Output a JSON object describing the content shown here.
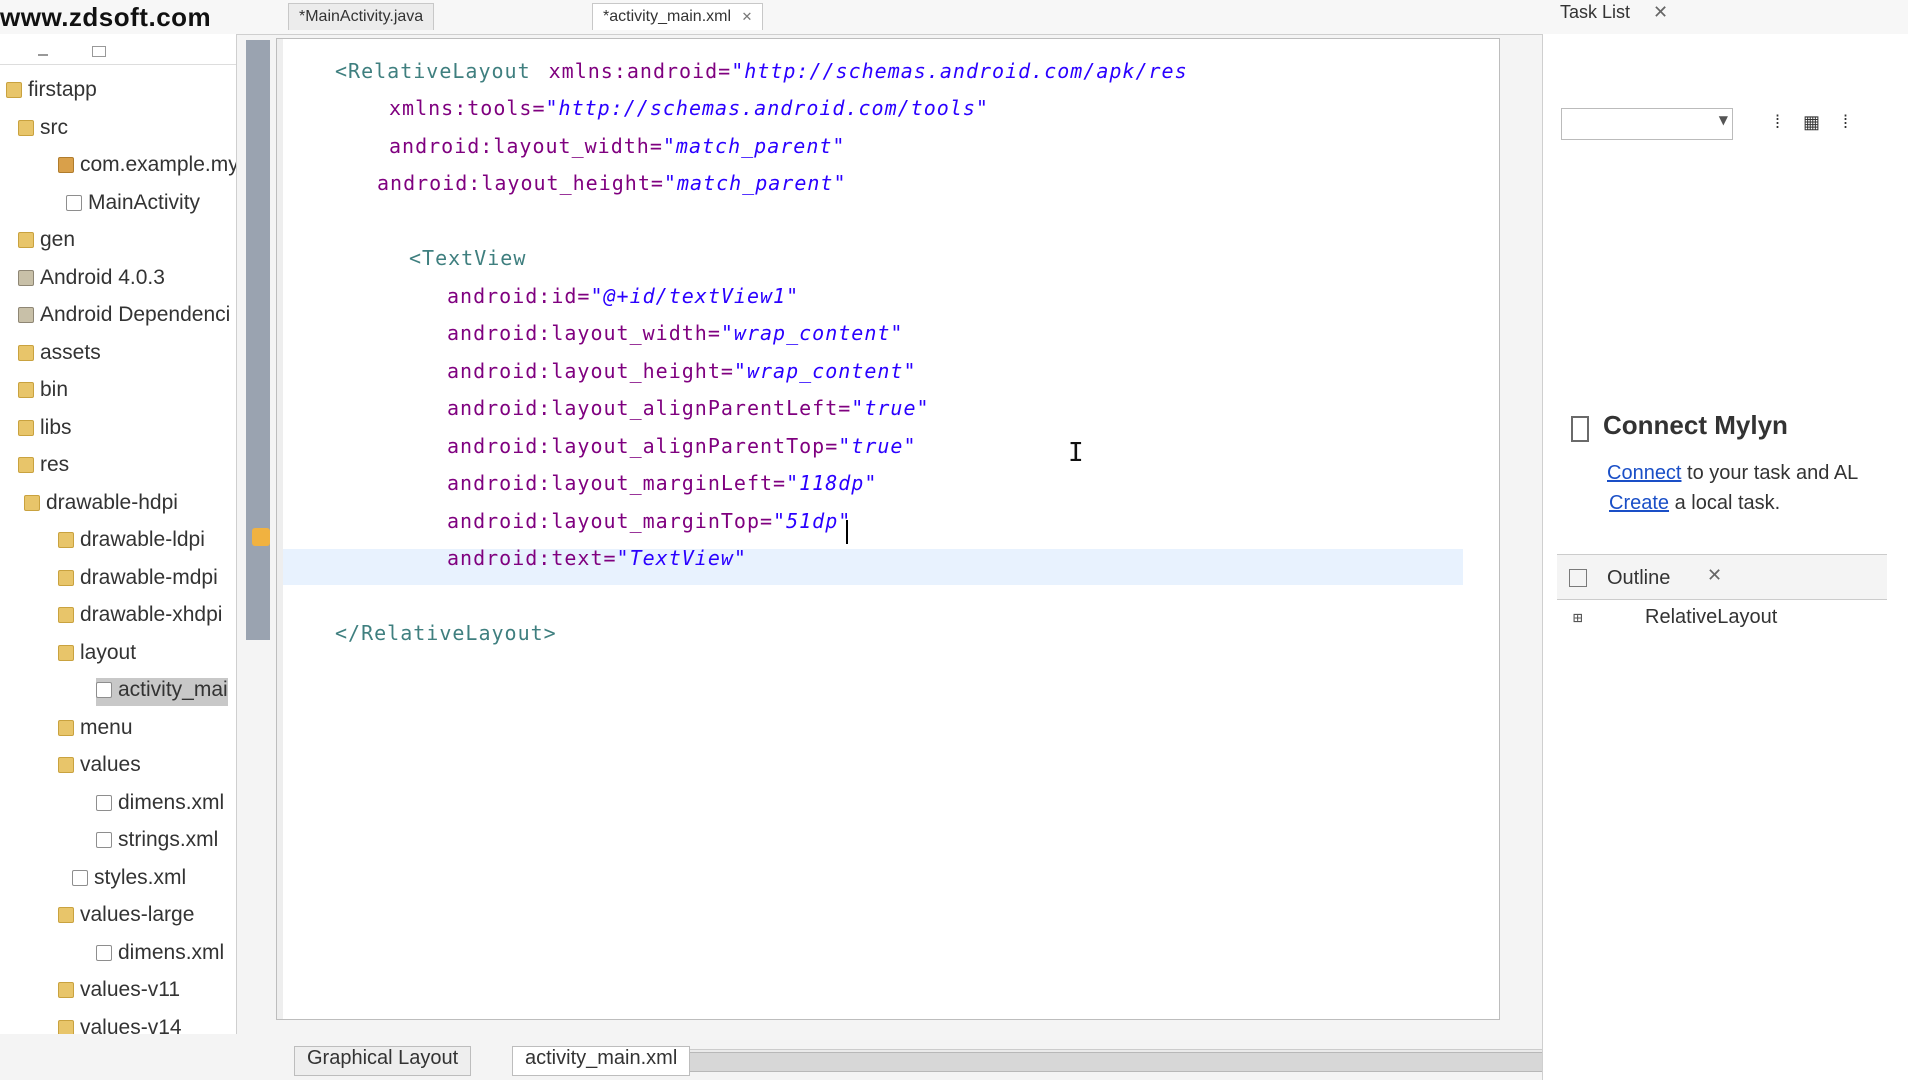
{
  "watermark": "www.zdsoft.com",
  "top_tabs": [
    {
      "label": "*MainActivity.java",
      "active": false
    },
    {
      "label": "*activity_main.xml",
      "active": true
    }
  ],
  "task_list_tab": "Task List",
  "explorer": {
    "items": [
      {
        "label": "firstapp",
        "icon": "project-icon"
      },
      {
        "label": "src",
        "icon": "folder-icon"
      },
      {
        "label": "com.example.my",
        "icon": "package-icon"
      },
      {
        "label": "MainActivity",
        "icon": "java-file-icon"
      },
      {
        "label": "gen",
        "icon": "folder-icon"
      },
      {
        "label": "Android 4.0.3",
        "icon": "library-icon"
      },
      {
        "label": "Android Dependenci",
        "icon": "library-icon"
      },
      {
        "label": "assets",
        "icon": "folder-icon"
      },
      {
        "label": "bin",
        "icon": "folder-icon"
      },
      {
        "label": "libs",
        "icon": "folder-icon"
      },
      {
        "label": "res",
        "icon": "folder-icon"
      },
      {
        "label": "drawable-hdpi",
        "icon": "folder-icon"
      },
      {
        "label": "drawable-ldpi",
        "icon": "folder-icon"
      },
      {
        "label": "drawable-mdpi",
        "icon": "folder-icon"
      },
      {
        "label": "drawable-xhdpi",
        "icon": "folder-icon"
      },
      {
        "label": "layout",
        "icon": "folder-icon"
      },
      {
        "label": "activity_mai",
        "icon": "xml-file-icon",
        "selected": true
      },
      {
        "label": "menu",
        "icon": "folder-icon"
      },
      {
        "label": "values",
        "icon": "folder-icon"
      },
      {
        "label": "dimens.xml",
        "icon": "xml-file-icon"
      },
      {
        "label": "strings.xml",
        "icon": "xml-file-icon"
      },
      {
        "label": "styles.xml",
        "icon": "xml-file-icon"
      },
      {
        "label": "values-large",
        "icon": "folder-icon"
      },
      {
        "label": "dimens.xml",
        "icon": "xml-file-icon"
      },
      {
        "label": "values-v11",
        "icon": "folder-icon"
      },
      {
        "label": "values-v14",
        "icon": "folder-icon"
      }
    ]
  },
  "editor": {
    "lines": [
      {
        "tag": "<RelativeLayout",
        "attr": "xmlns:android=",
        "val": "\"http://schemas.android.com/apk/res"
      },
      {
        "tag": "",
        "attr": "xmlns:tools=",
        "val": "\"http://schemas.android.com/tools\""
      },
      {
        "tag": "",
        "attr": "android:layout_width=",
        "val": "\"match_parent\""
      },
      {
        "tag": "",
        "attr": "android:layout_height=",
        "val": "\"match_parent\""
      },
      {
        "tag": "<TextView",
        "attr": "",
        "val": ""
      },
      {
        "tag": "",
        "attr": "android:id=",
        "val": "\"@+id/textView1\""
      },
      {
        "tag": "",
        "attr": "android:layout_width=",
        "val": "\"wrap_content\""
      },
      {
        "tag": "",
        "attr": "android:layout_height=",
        "val": "\"wrap_content\""
      },
      {
        "tag": "",
        "attr": "android:layout_alignParentLeft=",
        "val": "\"true\""
      },
      {
        "tag": "",
        "attr": "android:layout_alignParentTop=",
        "val": "\"true\""
      },
      {
        "tag": "",
        "attr": "android:layout_marginLeft=",
        "val": "\"118dp\""
      },
      {
        "tag": "",
        "attr": "android:layout_marginTop=",
        "val": "\"51dp\""
      },
      {
        "tag": "",
        "attr": "android:text=",
        "val": "\"TextView\""
      },
      {
        "tag": "</RelativeLayout>",
        "attr": "",
        "val": ""
      }
    ]
  },
  "bottom_tabs": [
    {
      "label": "Graphical Layout",
      "active": false
    },
    {
      "label": "activity_main.xml",
      "active": true
    }
  ],
  "right_pane": {
    "mylyn_title": "Connect Mylyn",
    "mylyn_connect_link": "Connect",
    "mylyn_text1": " to your task and AL",
    "mylyn_create_link": "Create",
    "mylyn_text2": " a local task.",
    "outline_title": "Outline",
    "outline_item": "RelativeLayout"
  }
}
